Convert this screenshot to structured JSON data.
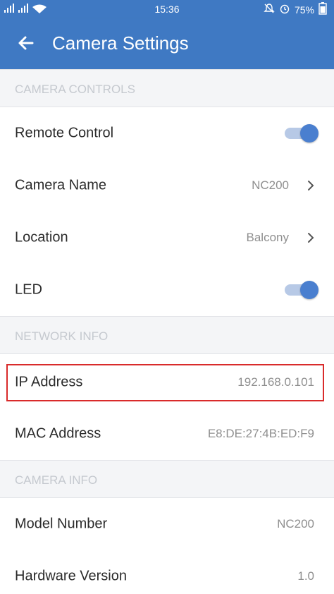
{
  "status_bar": {
    "signal": "ᴵᴵ ᴵᴵ ᵂᶦᶠᶦ",
    "time": "15:36",
    "battery": "75%",
    "icons": [
      "signal-icon",
      "wifi-icon",
      "mute-icon",
      "alarm-icon",
      "battery-icon"
    ]
  },
  "app_bar": {
    "title": "Camera Settings",
    "back_icon": "arrow-left-icon"
  },
  "sections": [
    {
      "header": "CAMERA CONTROLS",
      "rows": [
        {
          "label": "Remote Control",
          "type": "toggle",
          "on": true
        },
        {
          "label": "Camera Name",
          "value": "NC200",
          "type": "chevron"
        },
        {
          "label": "Location",
          "value": "Balcony",
          "type": "chevron"
        },
        {
          "label": "LED",
          "type": "toggle",
          "on": true
        }
      ]
    },
    {
      "header": "NETWORK INFO",
      "rows": [
        {
          "label": "IP Address",
          "value": "192.168.0.101"
        },
        {
          "label": "MAC Address",
          "value": "E8:DE:27:4B:ED:F9"
        }
      ]
    },
    {
      "header": "CAMERA INFO",
      "rows": [
        {
          "label": "Model Number",
          "value": "NC200"
        },
        {
          "label": "Hardware Version",
          "value": "1.0"
        }
      ]
    }
  ],
  "colors": {
    "primary": "#3f79c3",
    "toggle_on": "#4a7fcf",
    "highlight": "#d92b2b"
  }
}
